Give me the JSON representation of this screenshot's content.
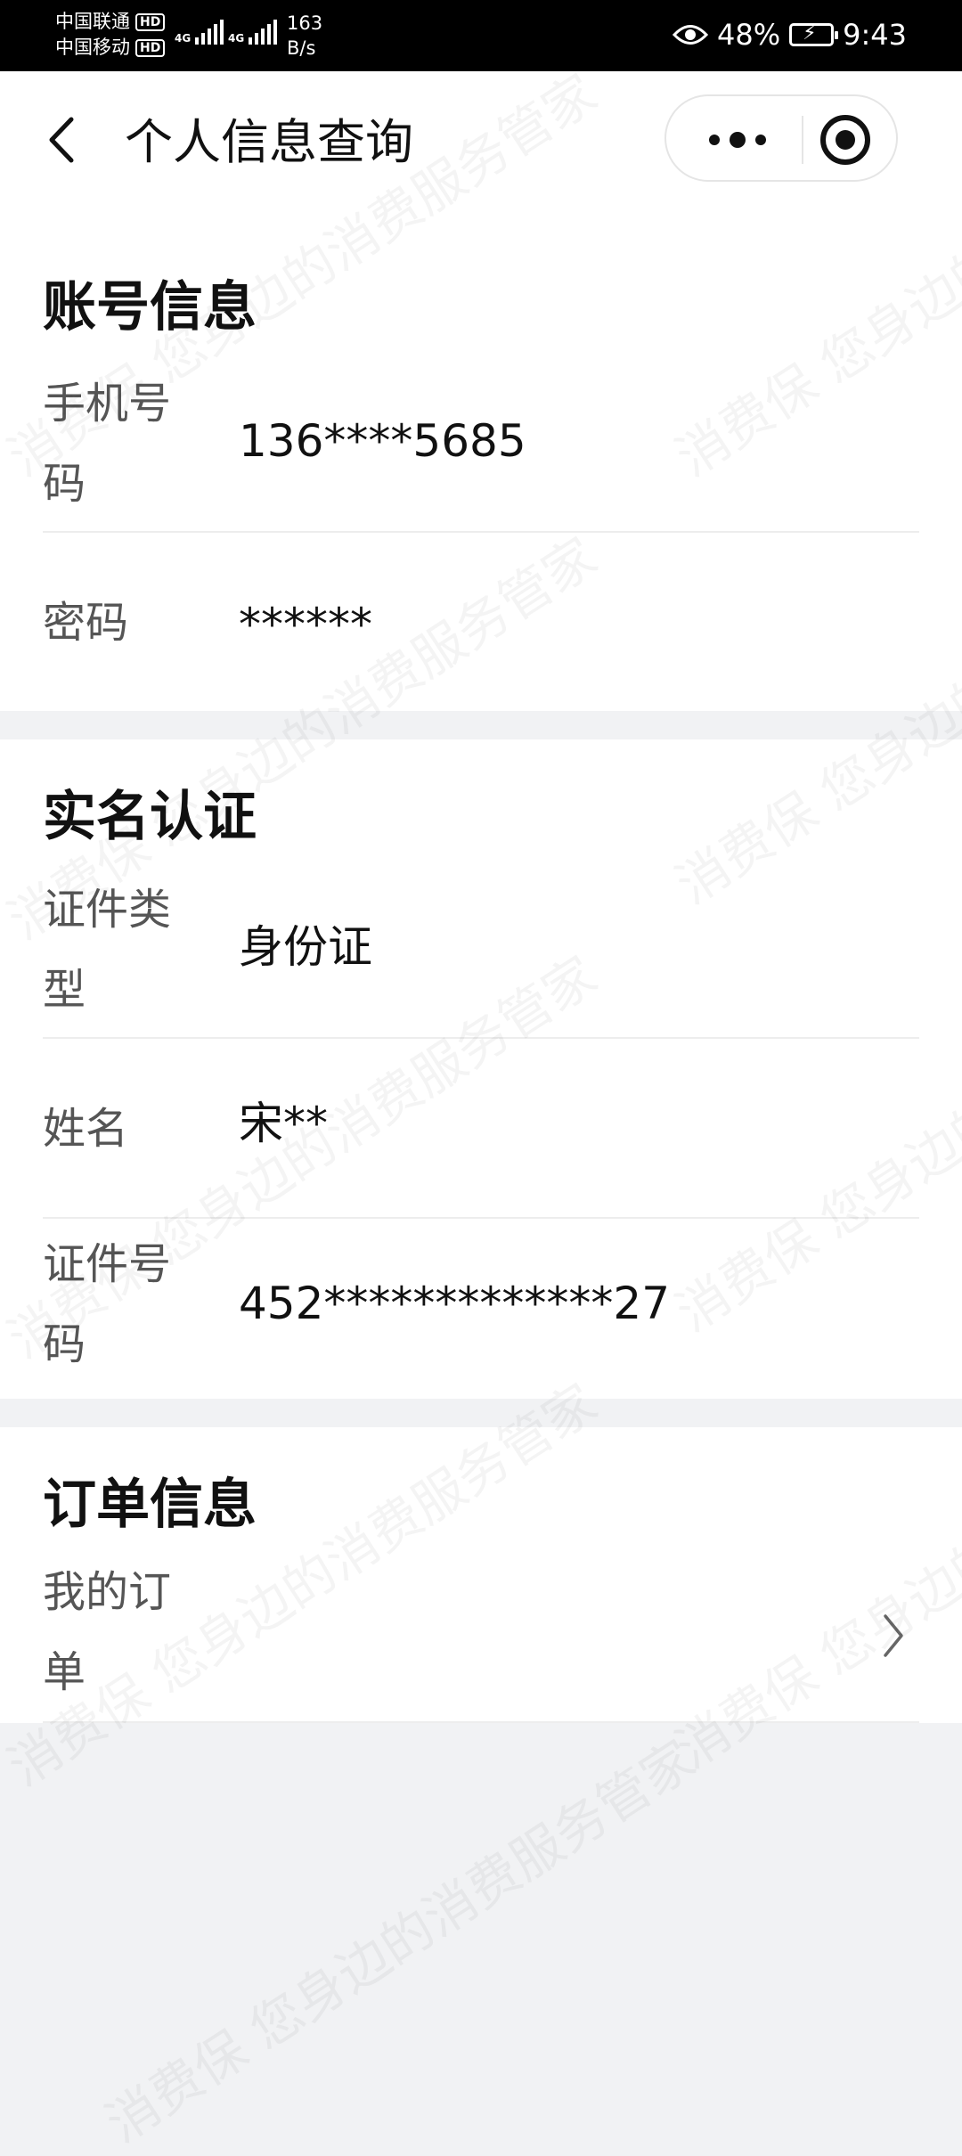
{
  "status_bar": {
    "carrier1": "中国联通",
    "carrier2": "中国移动",
    "hd": "HD",
    "network1": "4G",
    "network2": "4G",
    "speed_value": "163",
    "speed_unit": "B/s",
    "battery": "48%",
    "time": "9:43",
    "icons": [
      "eye-icon",
      "battery-charging-icon"
    ]
  },
  "nav": {
    "title": "个人信息查询",
    "icons": [
      "back-arrow-icon",
      "more-dots-icon",
      "close-target-icon"
    ]
  },
  "account": {
    "title": "账号信息",
    "phone_label": "手机号码",
    "phone_value": "136****5685",
    "password_label": "密码",
    "password_value": "******"
  },
  "realname": {
    "title": "实名认证",
    "idtype_label": "证件类型",
    "idtype_value": "身份证",
    "name_label": "姓名",
    "name_value": "宋**",
    "idnum_label": "证件号码",
    "idnum_value": "452*************27"
  },
  "orders": {
    "title": "订单信息",
    "my_orders_label": "我的订单"
  },
  "watermark": "消费保 您身边的消费服务管家",
  "colors": {
    "status_bar_bg": "#000000",
    "card_bg": "#ffffff",
    "page_bg": "#f1f2f4",
    "label_text": "#555555",
    "value_text": "#111111"
  }
}
